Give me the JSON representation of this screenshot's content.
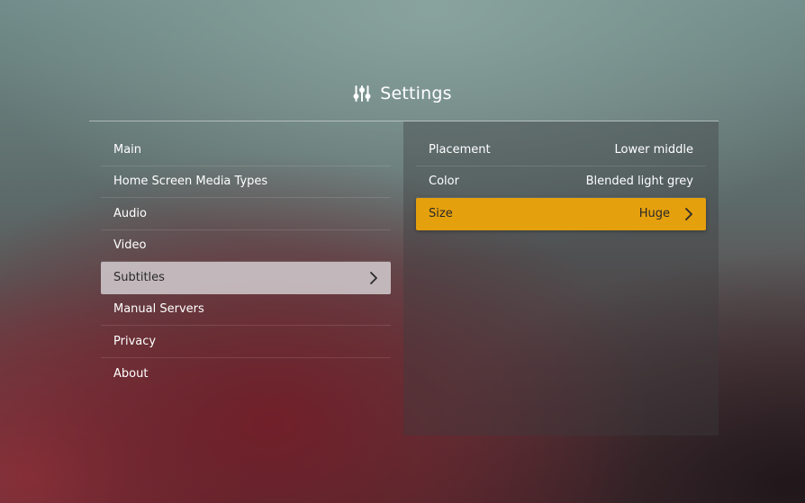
{
  "header": {
    "title": "Settings",
    "icon": "sliders-icon"
  },
  "menu": {
    "items": [
      {
        "label": "Main"
      },
      {
        "label": "Home Screen Media Types"
      },
      {
        "label": "Audio"
      },
      {
        "label": "Video"
      },
      {
        "label": "Subtitles",
        "selected": true
      },
      {
        "label": "Manual Servers"
      },
      {
        "label": "Privacy"
      },
      {
        "label": "About"
      }
    ]
  },
  "subtitles": {
    "options": [
      {
        "label": "Placement",
        "value": "Lower middle"
      },
      {
        "label": "Color",
        "value": "Blended light grey"
      },
      {
        "label": "Size",
        "value": "Huge",
        "focused": true
      }
    ]
  },
  "colors": {
    "accent": "#e5a00d",
    "selected_bg": "#d7d2d6"
  }
}
